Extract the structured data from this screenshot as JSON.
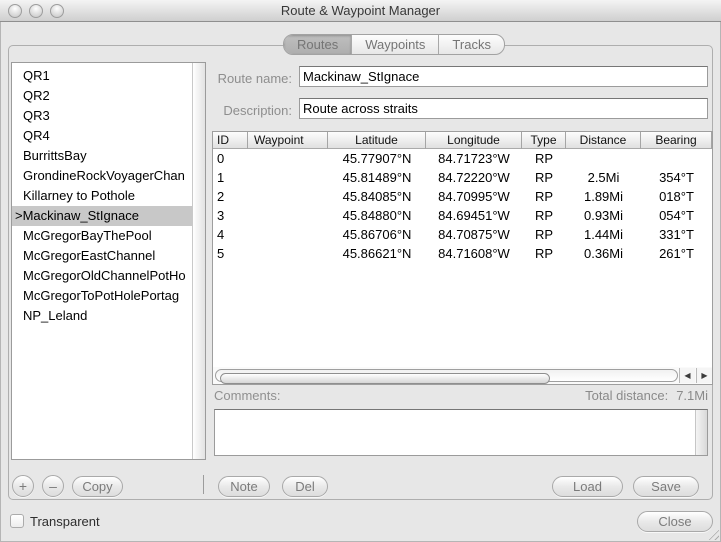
{
  "window": {
    "title": "Route & Waypoint Manager"
  },
  "tabs": {
    "items": [
      {
        "label": "Routes",
        "selected": true
      },
      {
        "label": "Waypoints",
        "selected": false
      },
      {
        "label": "Tracks",
        "selected": false
      }
    ]
  },
  "sidebar": {
    "items": [
      "QR1",
      "QR2",
      "QR3",
      "QR4",
      "BurrittsBay",
      "GrondineRockVoyagerChan",
      "Killarney to Pothole",
      "Mackinaw_StIgnace",
      "McGregorBayThePool",
      "McGregorEastChannel",
      "McGregorOldChannelPotHo",
      "McGregorToPotHolePortag",
      "NP_Leland"
    ],
    "selected_index": 7,
    "selected_prefix": ">"
  },
  "form": {
    "route_name_label": "Route name:",
    "route_name_value": "Mackinaw_StIgnace",
    "description_label": "Description:",
    "description_value": "Route across straits",
    "comments_label": "Comments:",
    "comments_value": "",
    "total_distance_label": "Total distance:",
    "total_distance_value": "7.1Mi"
  },
  "table": {
    "columns": [
      "ID",
      "Waypoint",
      "Latitude",
      "Longitude",
      "Type",
      "Distance",
      "Bearing"
    ],
    "rows": [
      [
        "0",
        "",
        "45.77907°N",
        "84.71723°W",
        "RP",
        "",
        ""
      ],
      [
        "1",
        "",
        "45.81489°N",
        "84.72220°W",
        "RP",
        "2.5Mi",
        "354°T"
      ],
      [
        "2",
        "",
        "45.84085°N",
        "84.70995°W",
        "RP",
        "1.89Mi",
        "018°T"
      ],
      [
        "3",
        "",
        "45.84880°N",
        "84.69451°W",
        "RP",
        "0.93Mi",
        "054°T"
      ],
      [
        "4",
        "",
        "45.86706°N",
        "84.70875°W",
        "RP",
        "1.44Mi",
        "331°T"
      ],
      [
        "5",
        "",
        "45.86621°N",
        "84.71608°W",
        "RP",
        "0.36Mi",
        "261°T"
      ]
    ]
  },
  "buttons": {
    "add": "+",
    "remove": "–",
    "copy": "Copy",
    "note": "Note",
    "del": "Del",
    "load": "Load",
    "save": "Save",
    "close": "Close"
  },
  "icons": {
    "scroll_left_arrow": "◀",
    "scroll_right_arrow": "▶"
  },
  "footer": {
    "transparent_label": "Transparent",
    "transparent_checked": false
  },
  "colors": {
    "window_bg": "#e7e7e7",
    "selection_bg": "#c8c8c8",
    "inactive_button_text": "#7b7b7b",
    "label_text": "#8e8e8e"
  }
}
